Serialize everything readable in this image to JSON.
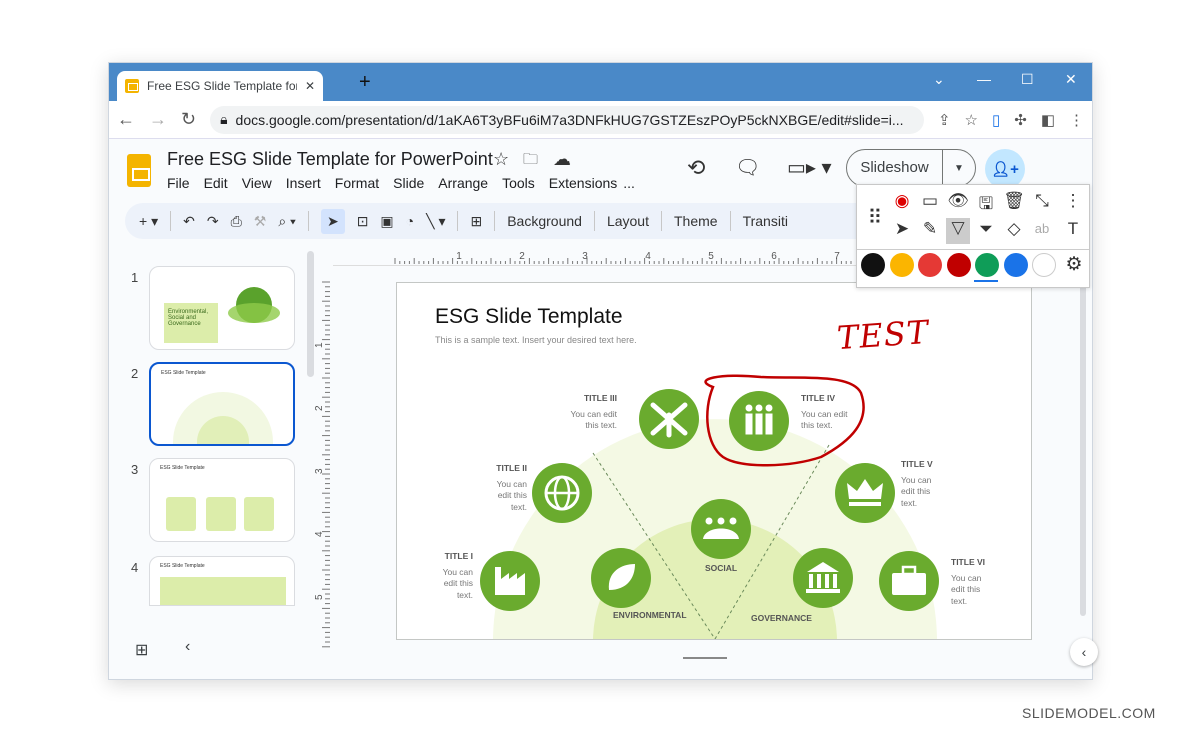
{
  "browser": {
    "tab_title": "Free ESG Slide Template for Powe",
    "url": "docs.google.com/presentation/d/1aKA6T3yBFu6iM7a3DNFkHUG7GSTZEszPOyP5ckNXBGE/edit#slide=i..."
  },
  "app": {
    "doc_title": "Free ESG Slide Template for PowerPoint",
    "menus": [
      "File",
      "Edit",
      "View",
      "Insert",
      "Format",
      "Slide",
      "Arrange",
      "Tools",
      "Extensions",
      "..."
    ],
    "slideshow_label": "Slideshow"
  },
  "toolbar": {
    "buttons": [
      "Background",
      "Layout",
      "Theme",
      "Transiti"
    ]
  },
  "ruler": {
    "top": [
      "1",
      "2",
      "3",
      "4",
      "5",
      "6",
      "7"
    ],
    "left": [
      "1",
      "2",
      "3",
      "4",
      "5"
    ]
  },
  "filmstrip": {
    "slides": [
      {
        "num": "1",
        "text": "Environmental, Social and Governance"
      },
      {
        "num": "2",
        "text": "ESG Slide Template"
      },
      {
        "num": "3",
        "text": "ESG Slide Template"
      },
      {
        "num": "4",
        "text": "ESG Slide Template"
      }
    ],
    "active": 2
  },
  "annotation_toolbar": {
    "colors": [
      "#111111",
      "#fbb500",
      "#e53935",
      "#c00000",
      "#0f9d58",
      "#1a73e8",
      "#ffffff"
    ],
    "selected_color": "#c00000",
    "tools": [
      "record",
      "present",
      "eye",
      "save",
      "trash",
      "collapse",
      "more",
      "pointer",
      "laser",
      "pen",
      "highlighter",
      "eraser",
      "text-eraser",
      "text"
    ]
  },
  "slide": {
    "title": "ESG Slide Template",
    "subtitle": "This is a sample text. Insert your desired text here.",
    "handwriting": "TEST",
    "accent": "#6aab2e",
    "items": [
      {
        "title": "TITLE I",
        "text": "You can edit this text."
      },
      {
        "title": "TITLE II",
        "text": "You can edit this text."
      },
      {
        "title": "TITLE III",
        "text": "You can edit this text."
      },
      {
        "title": "TITLE IV",
        "text": "You can edit this text."
      },
      {
        "title": "TITLE V",
        "text": "You can edit this text."
      },
      {
        "title": "TITLE VI",
        "text": "You can edit this text."
      }
    ],
    "pillars": [
      "ENVIRONMENTAL",
      "SOCIAL",
      "GOVERNANCE"
    ]
  },
  "watermark": "SLIDEMODEL.COM"
}
